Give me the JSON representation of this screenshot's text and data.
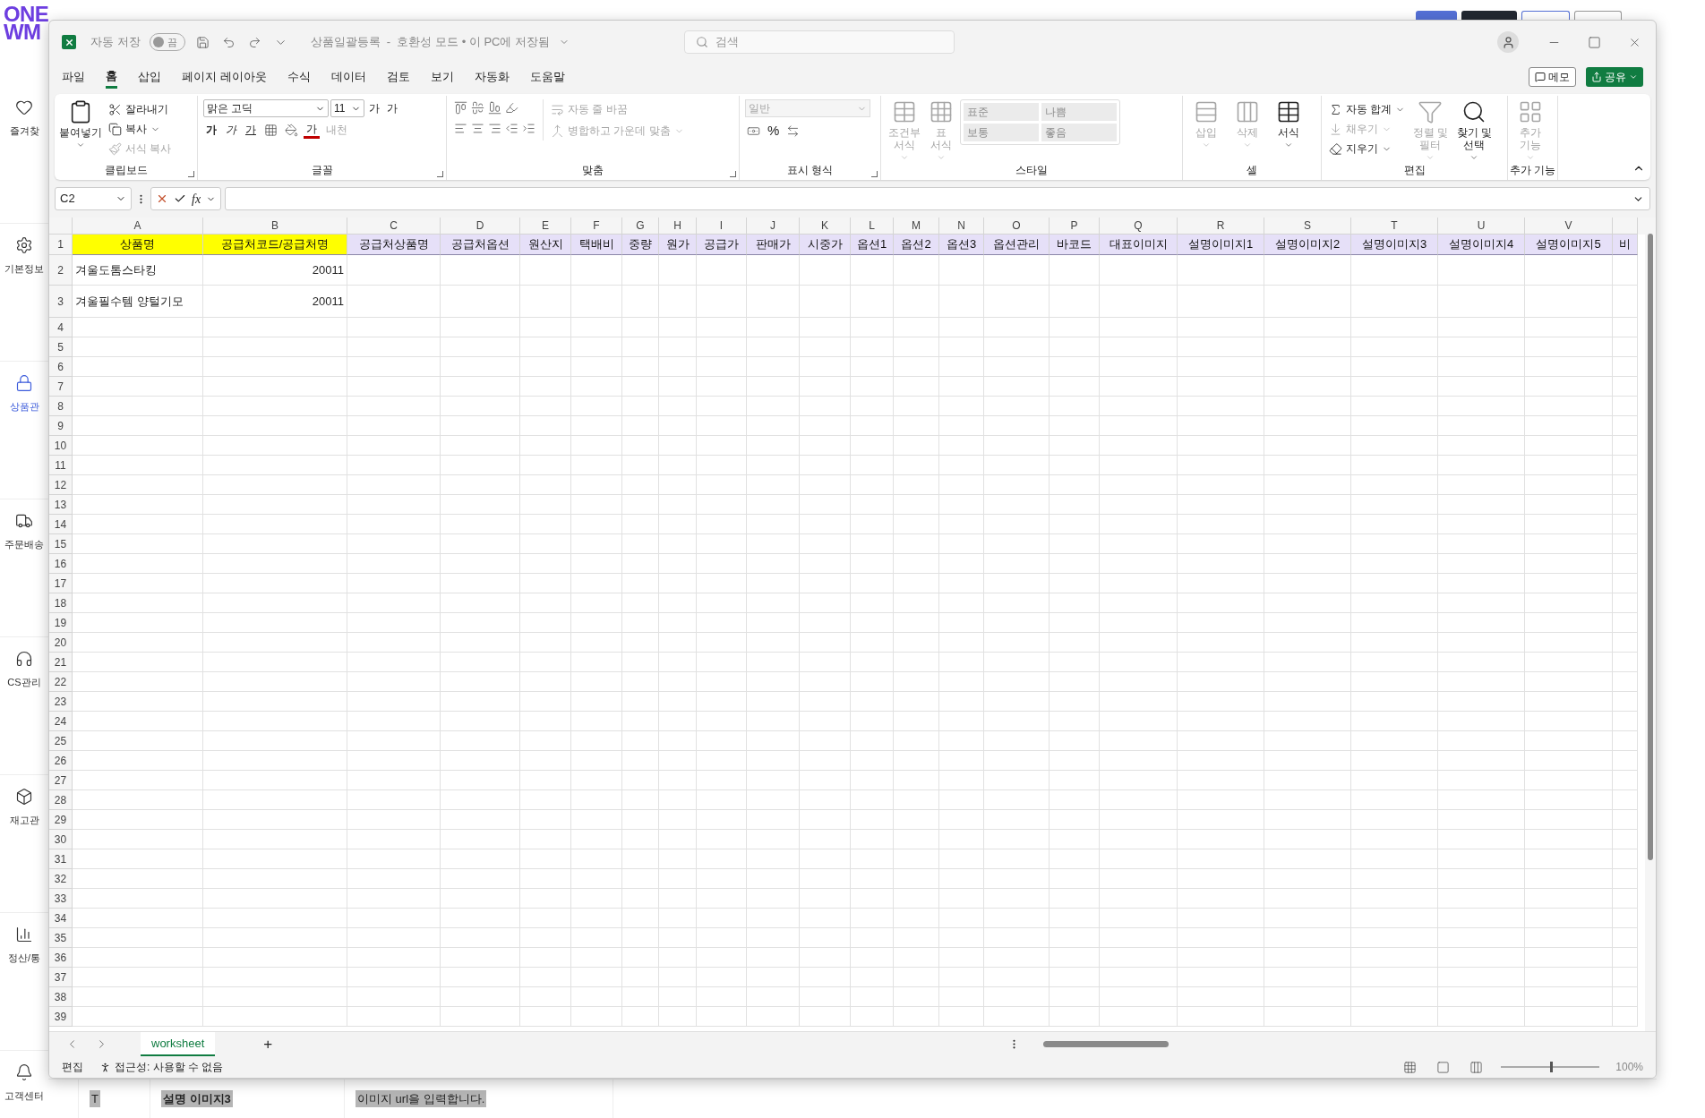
{
  "page": {
    "logo": [
      "ONE",
      "WM"
    ],
    "sidebar": [
      {
        "label": "즐겨찾",
        "selected": false
      },
      {
        "label": "기본정보",
        "selected": false
      },
      {
        "label": "상품관",
        "selected": true
      },
      {
        "label": "주문배송",
        "selected": false
      },
      {
        "label": "CS관리",
        "selected": false
      },
      {
        "label": "재고관",
        "selected": false
      },
      {
        "label": "정산/통",
        "selected": false
      },
      {
        "label": "고객센터",
        "selected": false
      }
    ],
    "bottom_row": [
      "T",
      "설명 이미지3",
      "이미지 url을 입력합니다."
    ]
  },
  "window": {
    "autosave_label": "자동 저장",
    "autosave": {
      "on": false,
      "label": "끔"
    },
    "title": "상품일괄등록  -  호환성 모드 • 이 PC에 저장됨",
    "search": {
      "placeholder": "검색"
    },
    "menu_tabs": [
      {
        "label": "파일",
        "selected": false
      },
      {
        "label": "홈",
        "selected": true
      },
      {
        "label": "삽입",
        "selected": false
      },
      {
        "label": "페이지 레이아웃",
        "selected": false
      },
      {
        "label": "수식",
        "selected": false
      },
      {
        "label": "데이터",
        "selected": false
      },
      {
        "label": "검토",
        "selected": false
      },
      {
        "label": "보기",
        "selected": false
      },
      {
        "label": "자동화",
        "selected": false
      },
      {
        "label": "도움말",
        "selected": false
      }
    ],
    "memo_button": "메모",
    "share_button": "공유",
    "ribbon": {
      "groups": [
        {
          "label": "클립보드",
          "launcher": true,
          "items": [
            {
              "label": "붙여넣기",
              "disabled": false
            },
            {
              "label": "잘라내기",
              "disabled": false
            },
            {
              "label": "복사",
              "disabled": false
            },
            {
              "label": "서식 복사",
              "disabled": true
            }
          ]
        },
        {
          "label": "글꼴",
          "launcher": true,
          "font": "맑은 고딕",
          "size": "11",
          "items": [
            {
              "label": "가",
              "kind": "grow",
              "disabled": false
            },
            {
              "label": "가",
              "kind": "shrink",
              "disabled": false
            },
            {
              "label": "가",
              "kind": "bold",
              "disabled": false
            },
            {
              "label": "가",
              "kind": "italic",
              "disabled": false
            },
            {
              "label": "가",
              "kind": "underline",
              "disabled": false
            },
            {
              "label": "가",
              "kind": "font_color",
              "disabled": false
            },
            {
              "label": "내천",
              "kind": "phonetic",
              "disabled": true
            }
          ]
        },
        {
          "label": "맞춤",
          "launcher": true,
          "items": [
            {
              "label": "자동 줄 바꿈",
              "disabled": true
            },
            {
              "label": "병합하고 가운데 맞춤",
              "disabled": true
            }
          ]
        },
        {
          "label": "표시 형식",
          "launcher": true,
          "format": {
            "value": "일반",
            "disabled": true
          },
          "items": [
            {
              "label": "%",
              "disabled": false
            }
          ]
        },
        {
          "label": "스타일",
          "launcher": false,
          "items": [
            {
              "label": "조건부 서식",
              "disabled": true
            },
            {
              "label": "표 서식",
              "disabled": true
            }
          ],
          "styles": [
            {
              "label": "표준",
              "disabled": true
            },
            {
              "label": "나쁨",
              "disabled": true
            },
            {
              "label": "보통",
              "disabled": true
            },
            {
              "label": "좋음",
              "disabled": true
            }
          ]
        },
        {
          "label": "셀",
          "launcher": false,
          "items": [
            {
              "label": "삽입",
              "disabled": true
            },
            {
              "label": "삭제",
              "disabled": true
            },
            {
              "label": "서식",
              "disabled": false
            }
          ]
        },
        {
          "label": "편집",
          "launcher": false,
          "items": [
            {
              "label": "자동 합계",
              "disabled": false
            },
            {
              "label": "채우기",
              "disabled": true
            },
            {
              "label": "지우기",
              "disabled": false
            },
            {
              "label": "정렬 및 필터",
              "disabled": true
            },
            {
              "label": "찾기 및 선택",
              "disabled": false
            }
          ]
        },
        {
          "label": "추가 기능",
          "launcher": false,
          "items": [
            {
              "label": "추가 기능",
              "disabled": true
            }
          ]
        }
      ]
    },
    "formula_bar": {
      "name_box": "C2",
      "fx": "fx"
    },
    "sheet": {
      "columns": [
        "A",
        "B",
        "C",
        "D",
        "E",
        "F",
        "G",
        "H",
        "I",
        "J",
        "K",
        "L",
        "M",
        "N",
        "O",
        "P",
        "Q",
        "R",
        "S",
        "T",
        "U",
        "V"
      ],
      "rows": [
        {
          "number": "1",
          "cells": [
            {
              "text": "상품명",
              "color": "#ffff00"
            },
            {
              "text": "공급처코드/공급처명",
              "color": "#ffff00"
            },
            {
              "text": "공급처상품명",
              "color": "#e6e0f8"
            },
            {
              "text": "공급처옵션",
              "color": "#e6e0f8"
            },
            {
              "text": "원산지",
              "color": "#e6e0f8"
            },
            {
              "text": "택배비",
              "color": "#e6e0f8"
            },
            {
              "text": "중량",
              "color": "#e6e0f8"
            },
            {
              "text": "원가",
              "color": "#e6e0f8"
            },
            {
              "text": "공급가",
              "color": "#e6e0f8"
            },
            {
              "text": "판매가",
              "color": "#e6e0f8"
            },
            {
              "text": "시중가",
              "color": "#e6e0f8"
            },
            {
              "text": "옵션1",
              "color": "#e6e0f8"
            },
            {
              "text": "옵션2",
              "color": "#e6e0f8"
            },
            {
              "text": "옵션3",
              "color": "#e6e0f8"
            },
            {
              "text": "옵션관리",
              "color": "#e6e0f8"
            },
            {
              "text": "바코드",
              "color": "#e6e0f8"
            },
            {
              "text": "대표이미지",
              "color": "#e6e0f8"
            },
            {
              "text": "설명이미지1",
              "color": "#e6e0f8"
            },
            {
              "text": "설명이미지2",
              "color": "#e6e0f8"
            },
            {
              "text": "설명이미지3",
              "color": "#e6e0f8"
            },
            {
              "text": "설명이미지4",
              "color": "#e6e0f8"
            },
            {
              "text": "설명이미지5",
              "color": "#e6e0f8"
            },
            {
              "text": "비",
              "color": "#e6e0f8"
            }
          ]
        },
        {
          "number": "2",
          "cells": [
            {
              "text": "겨울도톰스타킹",
              "kind": "text"
            },
            {
              "text": "20011",
              "kind": "number"
            }
          ]
        },
        {
          "number": "3",
          "cells": [
            {
              "text": "겨울필수템 양털기모",
              "kind": "text"
            },
            {
              "text": "20011",
              "kind": "number"
            }
          ]
        },
        {
          "number": "4"
        },
        {
          "number": "5"
        },
        {
          "number": "6"
        },
        {
          "number": "7"
        },
        {
          "number": "8"
        },
        {
          "number": "9"
        },
        {
          "number": "10"
        },
        {
          "number": "11"
        },
        {
          "number": "12"
        },
        {
          "number": "13"
        },
        {
          "number": "14"
        },
        {
          "number": "15"
        },
        {
          "number": "16"
        },
        {
          "number": "17"
        },
        {
          "number": "18"
        },
        {
          "number": "19"
        },
        {
          "number": "20"
        },
        {
          "number": "21"
        },
        {
          "number": "22"
        },
        {
          "number": "23"
        },
        {
          "number": "24"
        },
        {
          "number": "25"
        },
        {
          "number": "26"
        },
        {
          "number": "27"
        },
        {
          "number": "28"
        },
        {
          "number": "29"
        },
        {
          "number": "30"
        },
        {
          "number": "31"
        },
        {
          "number": "32"
        },
        {
          "number": "33"
        },
        {
          "number": "34"
        },
        {
          "number": "35"
        },
        {
          "number": "36"
        },
        {
          "number": "37"
        },
        {
          "number": "38"
        },
        {
          "number": "39"
        }
      ]
    },
    "sheet_tabs": [
      {
        "label": "worksheet",
        "selected": true
      }
    ],
    "add_sheet": "+",
    "status_bar": {
      "mode": "편집",
      "accessibility": "접근성: 사용할 수 없음",
      "zoom": {
        "label": "100%",
        "level": 0.5
      }
    }
  }
}
